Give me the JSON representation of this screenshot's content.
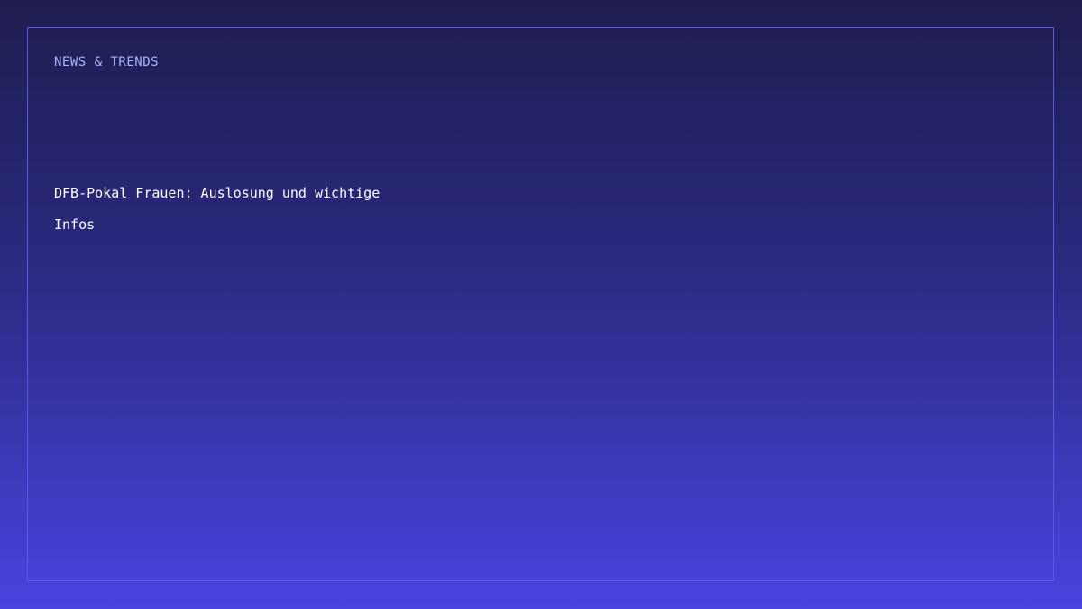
{
  "card": {
    "kicker": "NEWS & TRENDS",
    "headline_line1": "DFB-Pokal Frauen: Auslosung und wichtige",
    "headline_line2": "Infos"
  },
  "colors": {
    "background_top": "#1e1d4e",
    "background_bottom": "#4a43e0",
    "border": "#5b57e8",
    "kicker": "#a9b4ff",
    "headline": "#ffffff"
  }
}
